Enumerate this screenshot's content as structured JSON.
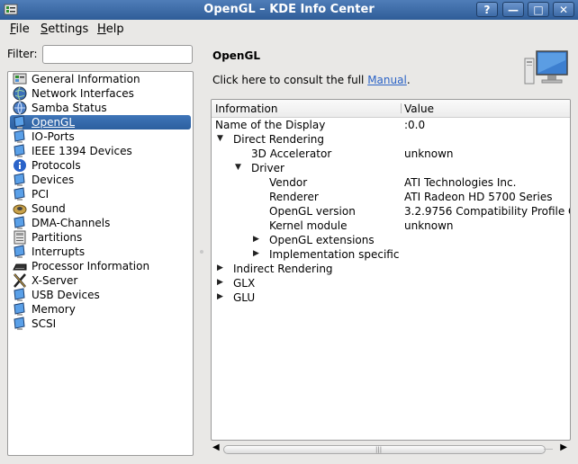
{
  "window": {
    "title": "OpenGL – KDE Info Center",
    "buttons": [
      "?",
      "—",
      "□",
      "✕"
    ]
  },
  "menubar": {
    "items": [
      {
        "label": "File",
        "mnemonic": "F",
        "rest": "ile"
      },
      {
        "label": "Settings",
        "mnemonic": "S",
        "rest": "ettings"
      },
      {
        "label": "Help",
        "mnemonic": "H",
        "rest": "elp"
      }
    ]
  },
  "filter": {
    "label": "Filter:",
    "value": "",
    "placeholder": ""
  },
  "sidebar": {
    "items": [
      {
        "label": "General Information",
        "icon": "info-computer-icon"
      },
      {
        "label": "Network Interfaces",
        "icon": "network-globe-icon"
      },
      {
        "label": "Samba Status",
        "icon": "samba-globe-icon"
      },
      {
        "label": "OpenGL",
        "icon": "opengl-monitor-icon",
        "selected": true
      },
      {
        "label": "IO-Ports",
        "icon": "io-ports-monitor-icon"
      },
      {
        "label": "IEEE 1394 Devices",
        "icon": "ieee1394-monitor-icon"
      },
      {
        "label": "Protocols",
        "icon": "protocols-info-icon"
      },
      {
        "label": "Devices",
        "icon": "devices-monitor-icon"
      },
      {
        "label": "PCI",
        "icon": "pci-monitor-icon"
      },
      {
        "label": "Sound",
        "icon": "sound-speaker-icon"
      },
      {
        "label": "DMA-Channels",
        "icon": "dma-monitor-icon"
      },
      {
        "label": "Partitions",
        "icon": "partitions-icon"
      },
      {
        "label": "Interrupts",
        "icon": "interrupts-monitor-icon"
      },
      {
        "label": "Processor Information",
        "icon": "processor-icon"
      },
      {
        "label": "X-Server",
        "icon": "xserver-icon"
      },
      {
        "label": "USB Devices",
        "icon": "usb-monitor-icon"
      },
      {
        "label": "Memory",
        "icon": "memory-monitor-icon"
      },
      {
        "label": "SCSI",
        "icon": "scsi-monitor-icon"
      }
    ]
  },
  "content": {
    "title": "OpenGL",
    "hint_prefix": "Click here to consult the full ",
    "hint_link": "Manual",
    "hint_suffix": ".",
    "columns": [
      "Information",
      "Value"
    ],
    "rows": [
      {
        "key": "Name of the Display",
        "value": ":0.0",
        "level": 0,
        "arrow": ""
      },
      {
        "key": "Direct Rendering",
        "value": "",
        "level": 1,
        "arrow": "down"
      },
      {
        "key": "3D Accelerator",
        "value": "unknown",
        "level": 2,
        "arrow": ""
      },
      {
        "key": "Driver",
        "value": "",
        "level": 2,
        "arrow": "down"
      },
      {
        "key": "Vendor",
        "value": "ATI Technologies Inc.",
        "level": 3,
        "arrow": ""
      },
      {
        "key": "Renderer",
        "value": "ATI Radeon HD 5700 Series",
        "level": 3,
        "arrow": ""
      },
      {
        "key": "OpenGL version",
        "value": "3.2.9756 Compatibility Profile C",
        "level": 3,
        "arrow": ""
      },
      {
        "key": "Kernel module",
        "value": "unknown",
        "level": 3,
        "arrow": ""
      },
      {
        "key": "OpenGL extensions",
        "value": "",
        "level": 3,
        "arrow": "right"
      },
      {
        "key": "Implementation specific",
        "value": "",
        "level": 3,
        "arrow": "right"
      },
      {
        "key": "Indirect Rendering",
        "value": "",
        "level": 1,
        "arrow": "right"
      },
      {
        "key": "GLX",
        "value": "",
        "level": 1,
        "arrow": "right"
      },
      {
        "key": "GLU",
        "value": "",
        "level": 1,
        "arrow": "right"
      }
    ]
  },
  "colors": {
    "titlebar": "#3a69a6",
    "selection": "#3069ad",
    "link": "#2b63c6"
  }
}
